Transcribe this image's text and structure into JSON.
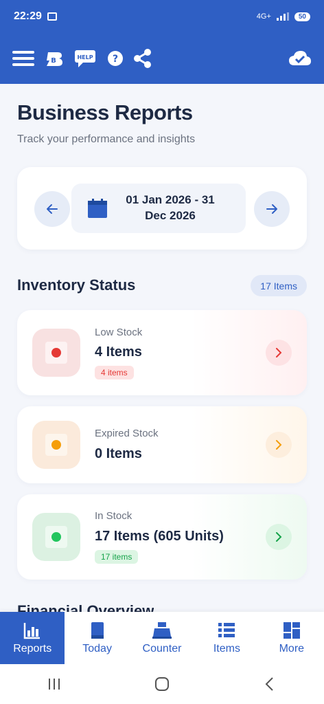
{
  "status_bar": {
    "time": "22:29",
    "network": "4G+",
    "battery": "50"
  },
  "header": {
    "title": "Business Reports",
    "subtitle": "Track your performance and insights",
    "help_label": "HELP"
  },
  "date_range": {
    "line1": "01 Jan 2026 - 31",
    "line2": "Dec 2026"
  },
  "inventory": {
    "title": "Inventory Status",
    "badge": "17 Items",
    "cards": [
      {
        "label": "Low Stock",
        "value": "4 Items",
        "tag": "4 items",
        "color": "#e53935"
      },
      {
        "label": "Expired Stock",
        "value": "0 Items",
        "color": "#f59e0b"
      },
      {
        "label": "In Stock",
        "value": "17 Items (605 Units)",
        "tag": "17 items",
        "color": "#22c55e"
      }
    ]
  },
  "next_section_title": "Financial Overview",
  "bottom_nav": {
    "items": [
      {
        "label": "Reports",
        "active": true
      },
      {
        "label": "Today"
      },
      {
        "label": "Counter"
      },
      {
        "label": "Items"
      },
      {
        "label": "More"
      }
    ]
  },
  "colors": {
    "primary": "#2f5fc4",
    "background": "#f4f6fb"
  }
}
